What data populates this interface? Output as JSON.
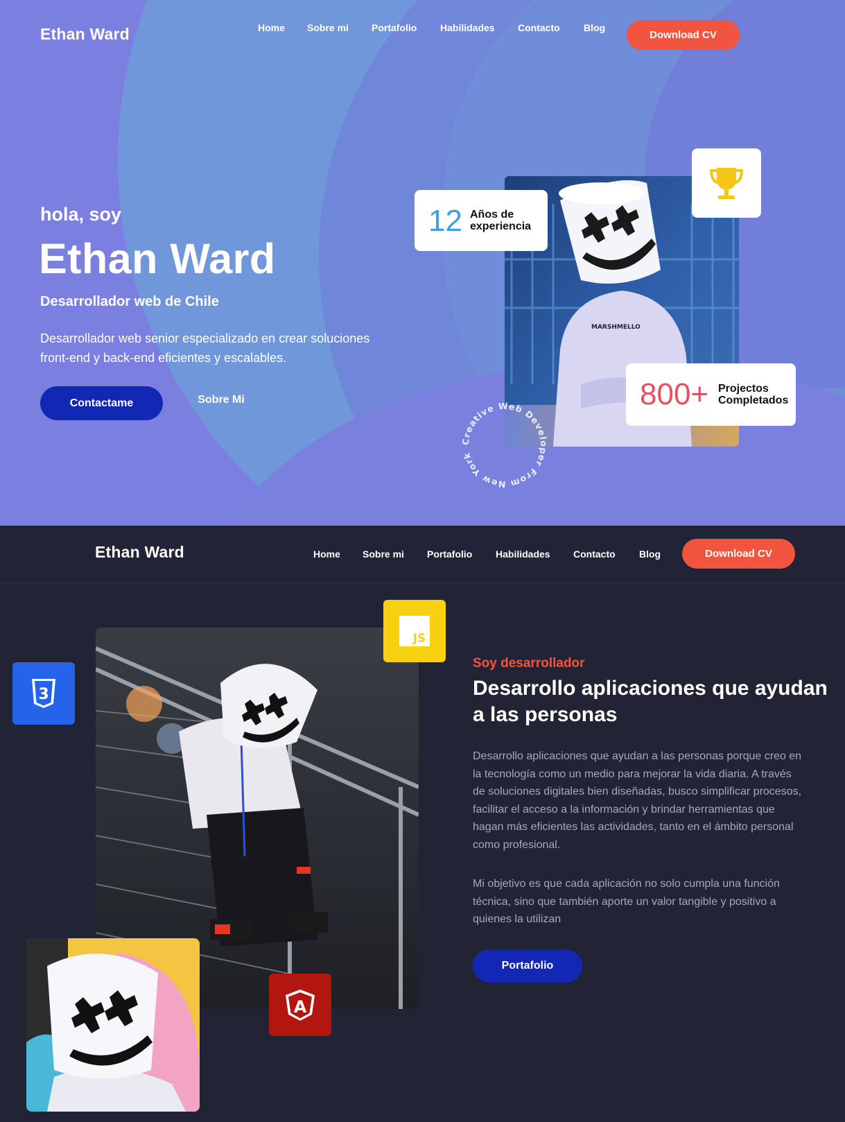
{
  "brand": "Ethan Ward",
  "nav": {
    "links": [
      "Home",
      "Sobre mi",
      "Portafolio",
      "Habilidades",
      "Contacto",
      "Blog"
    ],
    "cta": "Download CV"
  },
  "hero": {
    "greeting": "hola, soy",
    "name": "Ethan Ward",
    "role": "Desarrollador web de Chile",
    "description": "Desarrollador web senior especializado en crear soluciones front-end y back-end eficientes y escalables.",
    "primary_button": "Contactame",
    "secondary_button": "Sobre Mi",
    "stats": [
      {
        "number": "12",
        "label": "Años de experiencia",
        "color": "#3aa0e8"
      },
      {
        "number": "800+",
        "label": "Projectos Completados",
        "color": "#e4505f"
      }
    ],
    "circle_text": "Creative Web Developer From New York",
    "shirt_text": "MARSHMELLO"
  },
  "about": {
    "eyebrow": "Soy desarrollador",
    "title": "Desarrollo aplicaciones que ayudan a las personas",
    "paragraphs": [
      "Desarrollo aplicaciones que ayudan a las personas porque creo en la tecnología como un medio para mejorar la vida diaria. A través de soluciones digitales bien diseñadas, busco simplificar procesos, facilitar el acceso a la información y brindar herramientas que hagan más eficientes las actividades, tanto en el ámbito personal como profesional.",
      "Mi objetivo es que cada aplicación no solo cumpla una función técnica, sino que también aporte un valor tangible y positivo a quienes la utilizan"
    ],
    "button": "Portafolio",
    "tech_badges": [
      {
        "icon": "css3-icon",
        "label": "3",
        "color": "#2563eb"
      },
      {
        "icon": "javascript-icon",
        "label": "JS",
        "color": "#f7d010"
      },
      {
        "icon": "angular-icon",
        "label": "A",
        "color": "#b3150f"
      }
    ]
  },
  "colors": {
    "accent": "#f2553f",
    "primary_button": "#1228b5",
    "dark_bg": "#232336",
    "hero_bg": "#7b7fe0"
  }
}
